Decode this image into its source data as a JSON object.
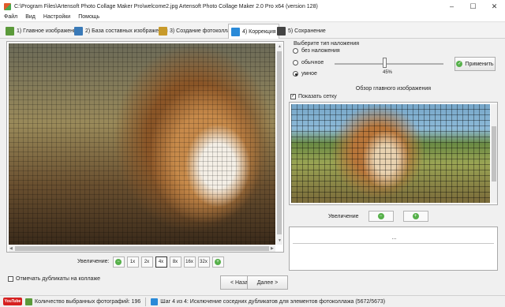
{
  "window": {
    "title": "C:\\Program Files\\Artensoft Photo Collage Maker Pro\\welcome2.jpg Artensoft Photo Collage Maker 2.0 Pro x64 (version 128)"
  },
  "menu": [
    "Файл",
    "Вид",
    "Настройки",
    "Помощь"
  ],
  "tabs": [
    {
      "label": "1) Главное изображение",
      "icon": "image-icon",
      "color": "#5b9a3a"
    },
    {
      "label": "2) База составных изображений",
      "icon": "database-icon",
      "color": "#3a7ab8"
    },
    {
      "label": "3) Создание фотоколлажа",
      "icon": "wand-icon",
      "color": "#c89a2a"
    },
    {
      "label": "4) Коррекция",
      "icon": "cube-icon",
      "color": "#2a8ad8"
    },
    {
      "label": "5) Сохранение",
      "icon": "save-icon",
      "color": "#444444"
    }
  ],
  "zoom": {
    "label": "Увеличение:",
    "levels": [
      "1x",
      "2x",
      "4x",
      "8x",
      "16x",
      "32x"
    ],
    "selected": "4x"
  },
  "duplicates_checkbox": "Отмечать дубликаты на коллаже",
  "nav": {
    "back": "< Назад",
    "next": "Далее >"
  },
  "overlay": {
    "title": "Выберите тип наложения",
    "options": [
      "без наложения",
      "обычное",
      "умное"
    ],
    "selected": "умное",
    "percent_text": "45%",
    "percent": 45,
    "apply": "Применить"
  },
  "preview": {
    "title": "Обзор главного изображения",
    "show_grid": "Показать сетку",
    "zoom_label": "Увеличение"
  },
  "info": {
    "text": "..."
  },
  "status": {
    "youtube": "YouTube",
    "selected_photos": "Количество выбранных фотографий: 196",
    "step": "Шаг 4 из 4: Исключение соседних дубликатов для элементов фотоколлажа (5672/5673)"
  }
}
